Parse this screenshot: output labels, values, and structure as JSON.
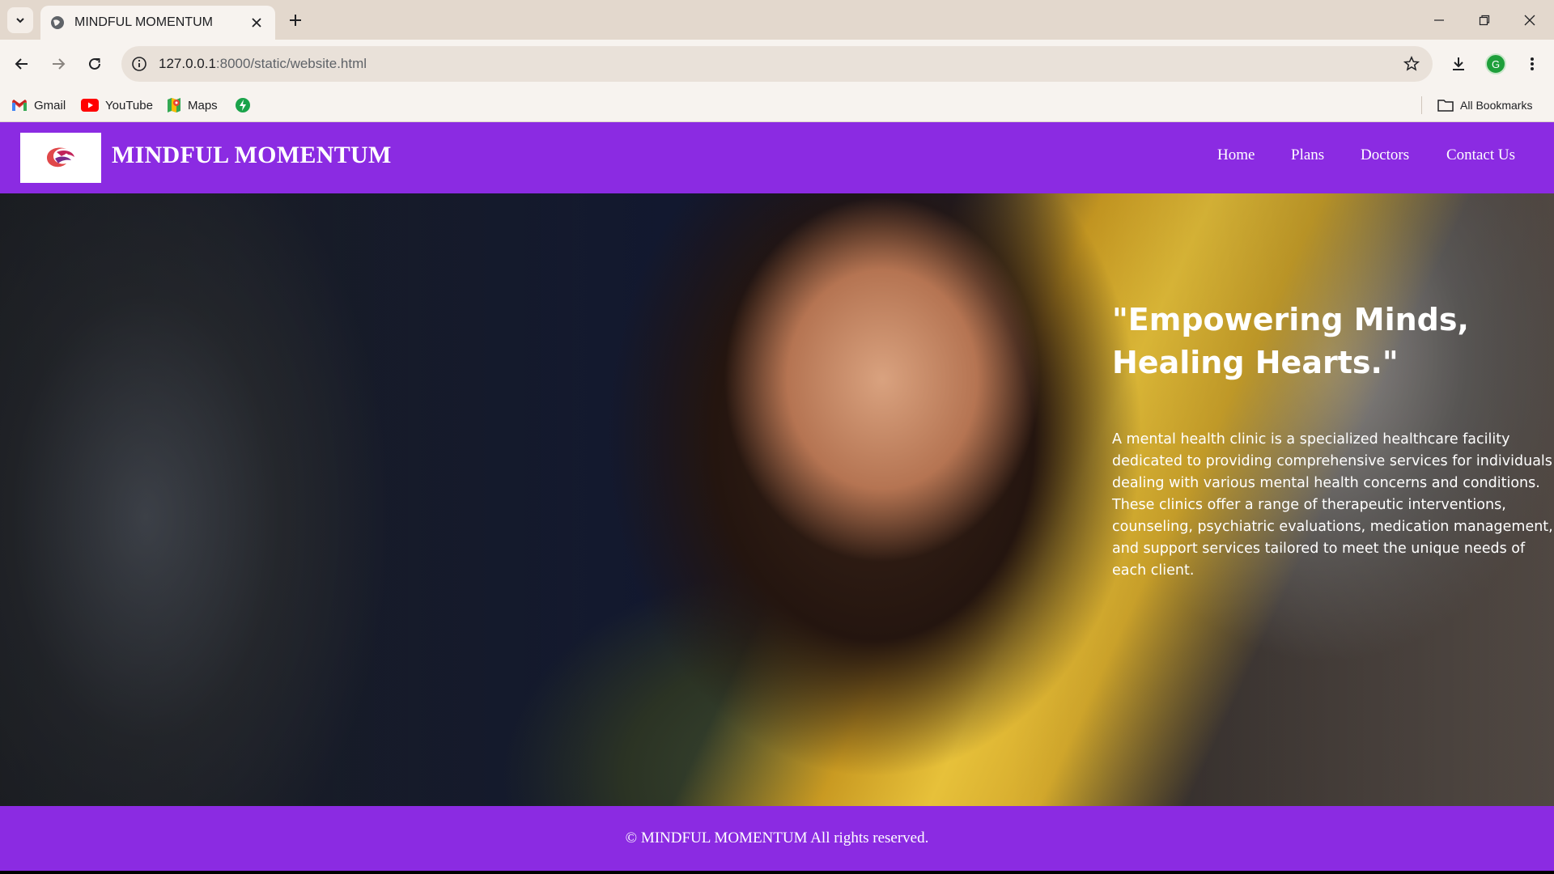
{
  "browser": {
    "tab_title": "MINDFUL MOMENTUM",
    "url_host": "127.0.0.1",
    "url_path": ":8000/static/website.html",
    "bookmarks": [
      {
        "label": "Gmail",
        "icon": "gmail-icon"
      },
      {
        "label": "YouTube",
        "icon": "youtube-icon"
      },
      {
        "label": "Maps",
        "icon": "maps-icon"
      },
      {
        "label": "",
        "icon": "green-bolt-icon"
      }
    ],
    "all_bookmarks_label": "All Bookmarks",
    "profile_initial": "G"
  },
  "site": {
    "brand": "MINDFUL MOMENTUM",
    "nav": [
      "Home",
      "Plans",
      "Doctors",
      "Contact Us"
    ],
    "hero": {
      "title": "\"Empowering Minds, Healing Hearts.\"",
      "description": "A mental health clinic is a specialized healthcare facility dedicated to providing comprehensive services for individuals dealing with various mental health concerns and conditions. These clinics offer a range of therapeutic interventions, counseling, psychiatric evaluations, medication management, and support services tailored to meet the unique needs of each client."
    },
    "footer": "© MINDFUL MOMENTUM All rights reserved.",
    "colors": {
      "brand_purple": "#8b2be2",
      "text": "#ffffff"
    }
  }
}
